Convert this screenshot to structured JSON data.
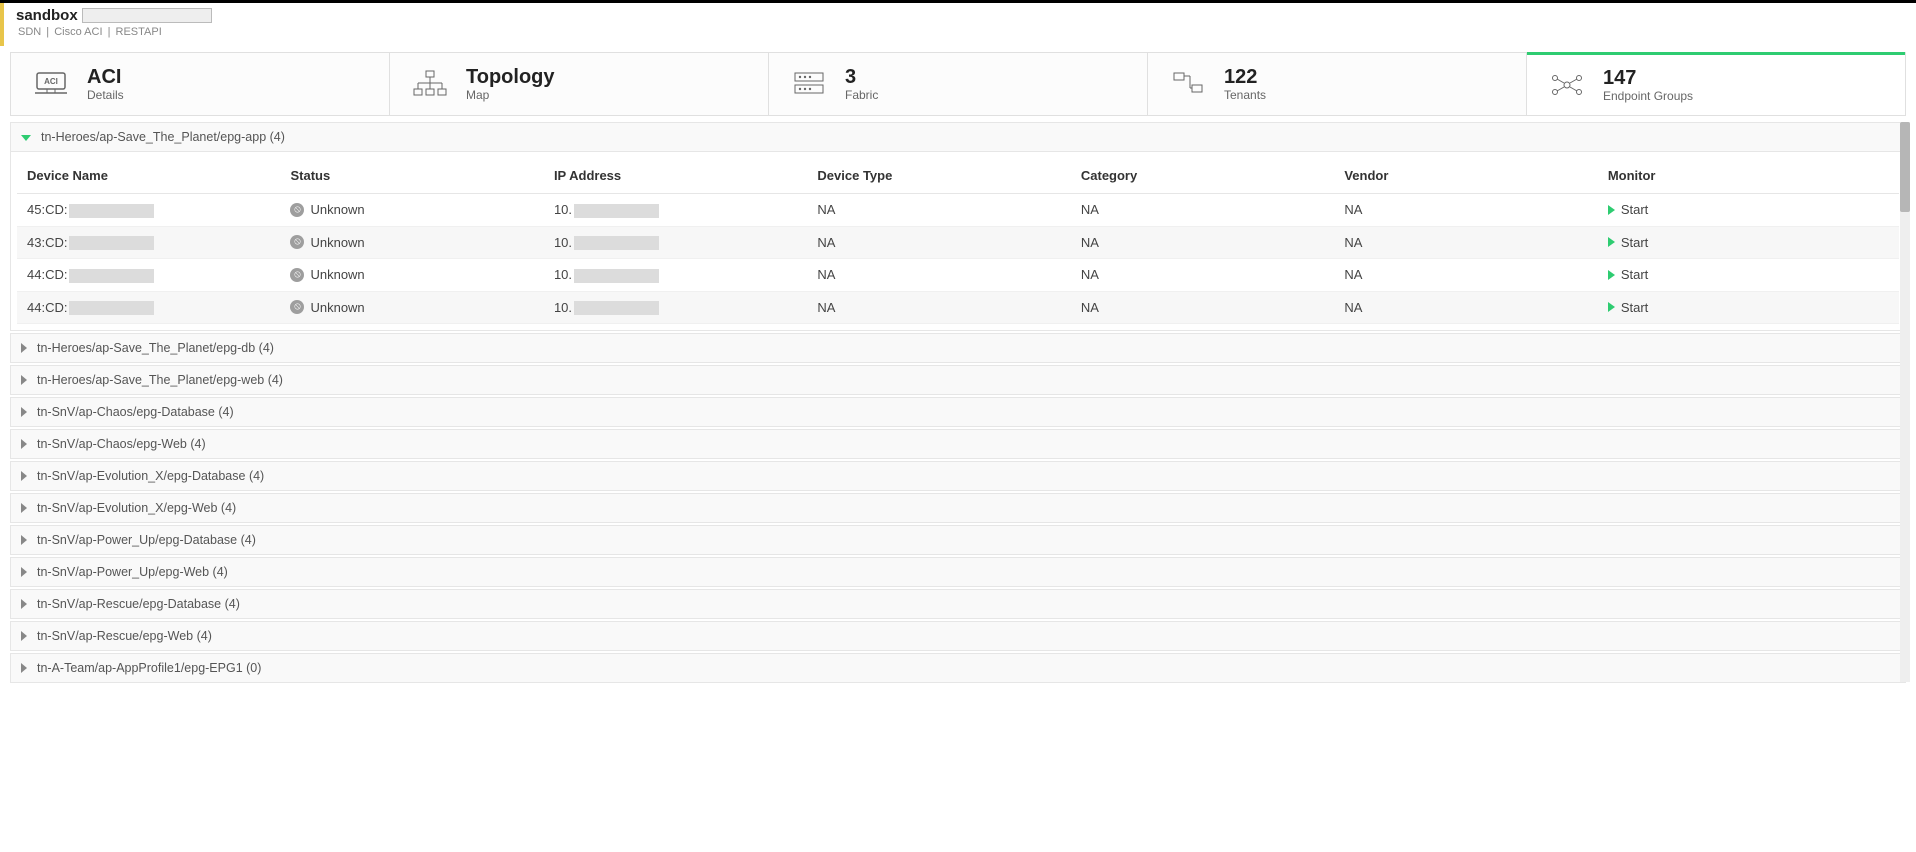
{
  "header": {
    "title": "sandbox",
    "crumbs": [
      "SDN",
      "Cisco ACI",
      "RESTAPI"
    ]
  },
  "summary": [
    {
      "big": "ACI",
      "small": "Details",
      "icon": "aci"
    },
    {
      "big": "Topology",
      "small": "Map",
      "icon": "topology"
    },
    {
      "big": "3",
      "small": "Fabric",
      "icon": "fabric"
    },
    {
      "big": "122",
      "small": "Tenants",
      "icon": "tenants"
    },
    {
      "big": "147",
      "small": "Endpoint Groups",
      "icon": "epg",
      "active": true
    }
  ],
  "expanded_group": {
    "label": "tn-Heroes/ap-Save_The_Planet/epg-app (4)",
    "columns": [
      "Device Name",
      "Status",
      "IP Address",
      "Device Type",
      "Category",
      "Vendor",
      "Monitor"
    ],
    "rows": [
      {
        "name_prefix": "45:CD:",
        "status": "Unknown",
        "ip_prefix": "10.",
        "type": "NA",
        "cat": "NA",
        "vendor": "NA",
        "monitor": "Start"
      },
      {
        "name_prefix": "43:CD:",
        "status": "Unknown",
        "ip_prefix": "10.",
        "type": "NA",
        "cat": "NA",
        "vendor": "NA",
        "monitor": "Start"
      },
      {
        "name_prefix": "44:CD:",
        "status": "Unknown",
        "ip_prefix": "10.",
        "type": "NA",
        "cat": "NA",
        "vendor": "NA",
        "monitor": "Start"
      },
      {
        "name_prefix": "44:CD:",
        "status": "Unknown",
        "ip_prefix": "10.",
        "type": "NA",
        "cat": "NA",
        "vendor": "NA",
        "monitor": "Start"
      }
    ]
  },
  "collapsed_groups": [
    "tn-Heroes/ap-Save_The_Planet/epg-db (4)",
    "tn-Heroes/ap-Save_The_Planet/epg-web (4)",
    "tn-SnV/ap-Chaos/epg-Database (4)",
    "tn-SnV/ap-Chaos/epg-Web (4)",
    "tn-SnV/ap-Evolution_X/epg-Database (4)",
    "tn-SnV/ap-Evolution_X/epg-Web (4)",
    "tn-SnV/ap-Power_Up/epg-Database (4)",
    "tn-SnV/ap-Power_Up/epg-Web (4)",
    "tn-SnV/ap-Rescue/epg-Database (4)",
    "tn-SnV/ap-Rescue/epg-Web (4)",
    "tn-A-Team/ap-AppProfile1/epg-EPG1 (0)"
  ]
}
